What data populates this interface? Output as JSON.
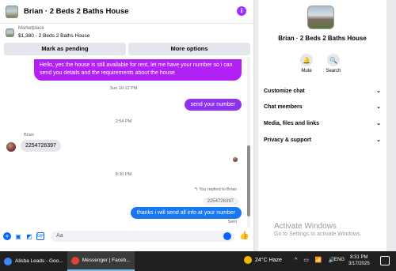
{
  "header": {
    "title": "Brian · 2 Beds 2 Baths House",
    "info_icon": "info-icon"
  },
  "marketplace": {
    "label": "Marketplace",
    "item": "$1,380 - 2 Beds 2 Baths House"
  },
  "actions": {
    "mark_pending": "Mark as pending",
    "more_options": "More options"
  },
  "messages": {
    "first_bubble": "Hello, yes the house is still available for rent, let me have your number so i can send you details and the requirements about the house",
    "ts1": "Sun 10:12 PM",
    "out1": "send your number",
    "ts2": "2:54 PM",
    "sender_name": "Brian",
    "in1": "2254726397",
    "ts3": "8:30 PM",
    "reply_note": "You replied to Brian",
    "quoted": "2254726397",
    "out2": "thanks i will send all info at your number",
    "sent_label": "Sent"
  },
  "composer": {
    "placeholder": "Aa"
  },
  "info_panel": {
    "title": "Brian · 2 Beds 2 Baths House",
    "mute_label": "Mute",
    "search_label": "Search",
    "menu": [
      "Customize chat",
      "Chat members",
      "Media, files and links",
      "Privacy & support"
    ],
    "activate_title": "Activate Windows",
    "activate_sub": "Go to Settings to activate Windows."
  },
  "taskbar": {
    "task1": "Alisba Leads - Goo...",
    "task2": "Messenger | Faceb...",
    "weather": "24°C  Haze",
    "lang": "ENG",
    "time": "8:31 PM",
    "date": "3/17/2025"
  },
  "colors": {
    "accent": "#0866ff",
    "purple": "#b120f5",
    "taskbar": "#202020"
  }
}
